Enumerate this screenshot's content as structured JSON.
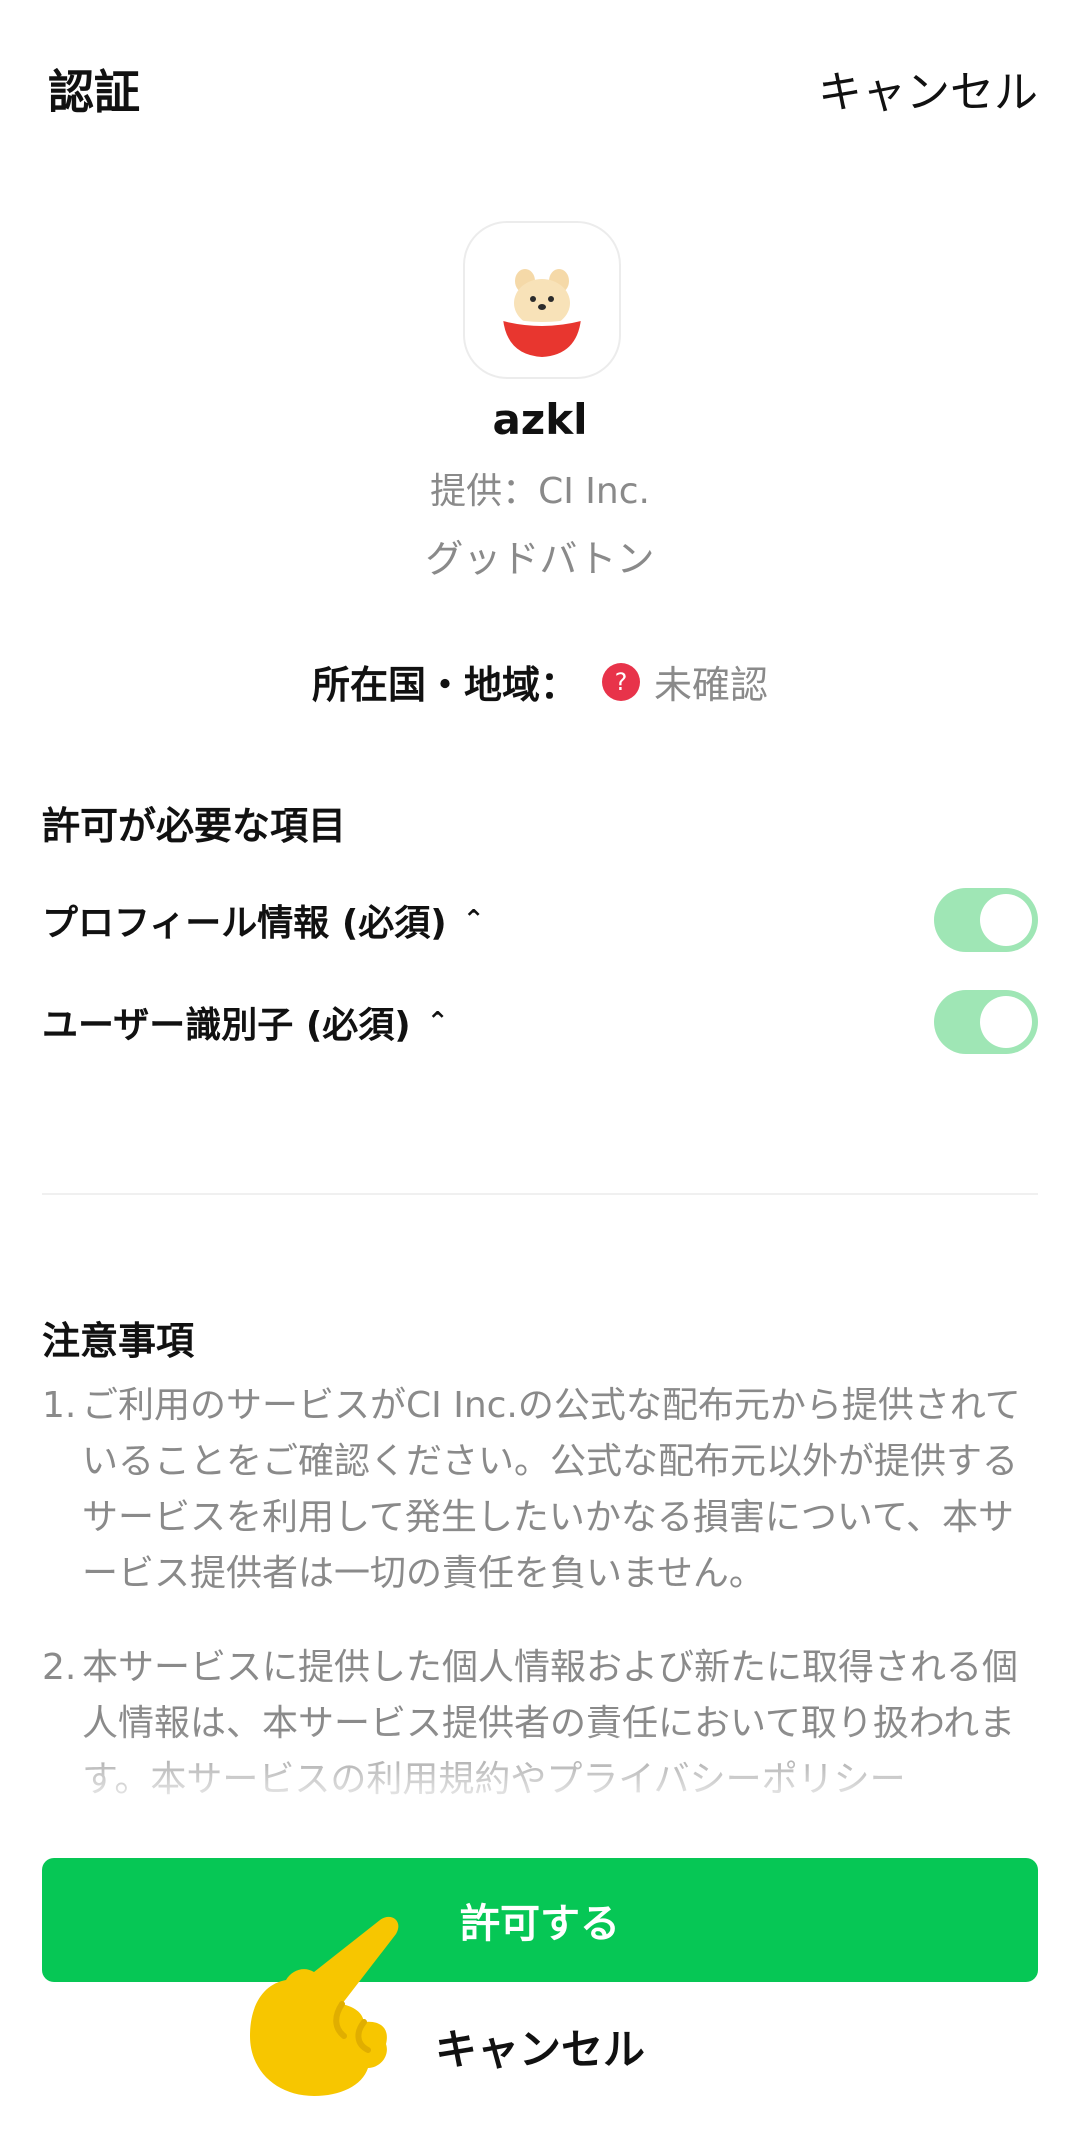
{
  "header": {
    "title": "認証",
    "cancel_label": "キャンセル"
  },
  "app": {
    "icon": "bear-in-bowl-icon",
    "name": "azkl",
    "provider": "提供：CI Inc.",
    "category": "グッドバトン"
  },
  "region": {
    "label": "所在国・地域：",
    "status_icon": "question-icon",
    "value": "未確認"
  },
  "permissions": {
    "title": "許可が必要な項目",
    "items": [
      {
        "label": "プロフィール情報 (必須)",
        "enabled": true
      },
      {
        "label": "ユーザー識別子 (必須)",
        "enabled": true
      }
    ]
  },
  "notice": {
    "title": "注意事項",
    "items": [
      {
        "num": "1.",
        "text": "ご利用のサービスがCI Inc.の公式な配布元から提供されていることをご確認ください。公式な配布元以外が提供するサービスを利用して発生したいかなる損害について、本サービス提供者は一切の責任を負いません。"
      },
      {
        "num": "2.",
        "text": "本サービスに提供した個人情報および新たに取得される個人情報は、本サービス提供者の責任において取り扱われます。本サービスの利用規約やプライバシーポリシー"
      }
    ]
  },
  "actions": {
    "allow_label": "許可する",
    "cancel_label": "キャンセル"
  },
  "colors": {
    "accent": "#06c755",
    "toggle_on": "#9fe6b5",
    "warning": "#e8334a",
    "pointer": "#f7c600"
  }
}
